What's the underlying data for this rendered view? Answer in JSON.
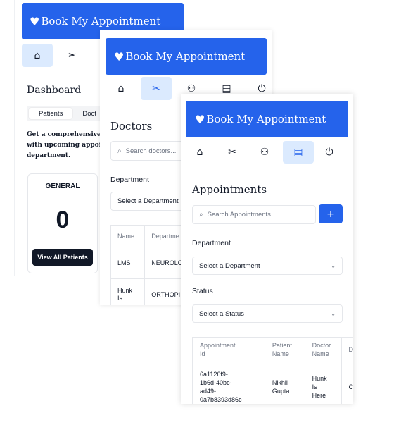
{
  "app": {
    "title": "Book My Appointment",
    "heart_icon": "heart-icon"
  },
  "nav": {
    "home_icon": "home-icon",
    "scissors_icon": "scissors-icon",
    "users_icon": "users-icon",
    "clipboard_icon": "clipboard-icon",
    "power_icon": "power-icon"
  },
  "dashboard": {
    "title": "Dashboard",
    "tabs": [
      "Patients",
      "Doct"
    ],
    "description_lines": [
      "Get a comprehensive o",
      "with upcoming appoin",
      "department."
    ],
    "card": {
      "title": "GENERAL",
      "count": "0",
      "button": "View All Patients"
    }
  },
  "doctors": {
    "title": "Doctors",
    "search_placeholder": "Search doctors...",
    "department_label": "Department",
    "department_select": "Select a Department",
    "table": {
      "headers": [
        "Name",
        "Departme"
      ],
      "rows": [
        {
          "name": "LMS",
          "department": "NEUROLC"
        },
        {
          "name_lines": [
            "Hunk",
            "Is"
          ],
          "department": "ORTHOPI"
        }
      ]
    }
  },
  "appointments": {
    "title": "Appointments",
    "search_placeholder": "Search Appointments...",
    "add_label": "+",
    "department_label": "Department",
    "department_select": "Select a Department",
    "status_label": "Status",
    "status_select": "Select a Status",
    "table": {
      "headers": [
        {
          "lines": [
            "Appointment",
            "Id"
          ]
        },
        {
          "lines": [
            "Patient",
            "Name"
          ]
        },
        {
          "lines": [
            "Doctor",
            "Name"
          ]
        },
        {
          "lines": [
            "D"
          ]
        }
      ],
      "row": {
        "id_lines": [
          "6a1126f9-",
          "1b6d-40bc-",
          "ad49-",
          "0a7b8393d86c"
        ],
        "patient_lines": [
          "Nikhil",
          "Gupta"
        ],
        "doctor_lines": [
          "Hunk",
          "Is",
          "Here"
        ],
        "extra": "C"
      }
    }
  },
  "colors": {
    "primary": "#2563eb",
    "active_nav": "#dbeafe",
    "border": "#e5e7eb"
  }
}
